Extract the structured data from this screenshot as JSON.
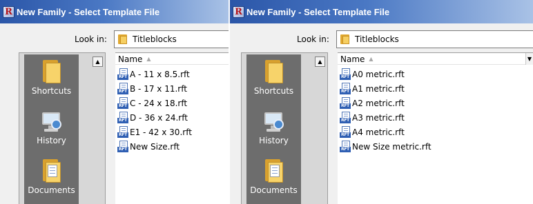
{
  "dialogs": [
    {
      "title": "New Family - Select Template File",
      "look_in_label": "Look in:",
      "look_in_value": "Titleblocks",
      "places": [
        {
          "label": "Shortcuts",
          "icon": "shortcuts-folder-icon"
        },
        {
          "label": "History",
          "icon": "history-icon"
        },
        {
          "label": "Documents",
          "icon": "documents-icon"
        }
      ],
      "column_header": "Name",
      "sort_indicator": "▲",
      "files": [
        {
          "name": "A - 11 x 8.5.rft",
          "type_badge": "RFT"
        },
        {
          "name": "B - 17 x 11.rft",
          "type_badge": "RFT"
        },
        {
          "name": "C - 24 x 18.rft",
          "type_badge": "RFT"
        },
        {
          "name": "D - 36 x 24.rft",
          "type_badge": "RFT"
        },
        {
          "name": "E1 - 42 x 30.rft",
          "type_badge": "RFT"
        },
        {
          "name": "New Size.rft",
          "type_badge": "RFT"
        }
      ]
    },
    {
      "title": "New Family - Select Template File",
      "look_in_label": "Look in:",
      "look_in_value": "Titleblocks",
      "places": [
        {
          "label": "Shortcuts",
          "icon": "shortcuts-folder-icon"
        },
        {
          "label": "History",
          "icon": "history-icon"
        },
        {
          "label": "Documents",
          "icon": "documents-icon"
        }
      ],
      "column_header": "Name",
      "sort_indicator": "▲",
      "files": [
        {
          "name": "A0 metric.rft",
          "type_badge": "RFT"
        },
        {
          "name": "A1 metric.rft",
          "type_badge": "RFT"
        },
        {
          "name": "A2 metric.rft",
          "type_badge": "RFT"
        },
        {
          "name": "A3 metric.rft",
          "type_badge": "RFT"
        },
        {
          "name": "A4 metric.rft",
          "type_badge": "RFT"
        },
        {
          "name": "New Size metric.rft",
          "type_badge": "RFT"
        }
      ]
    }
  ],
  "app_icon_letter": "R",
  "scroll_up_glyph": "▲",
  "dropdown_glyph": "▼",
  "colors": {
    "titlebar_start": "#2b56a8",
    "titlebar_end": "#a9c2e6",
    "places_bar": "#6d6d6d",
    "rft_badge": "#2f5fb3"
  }
}
